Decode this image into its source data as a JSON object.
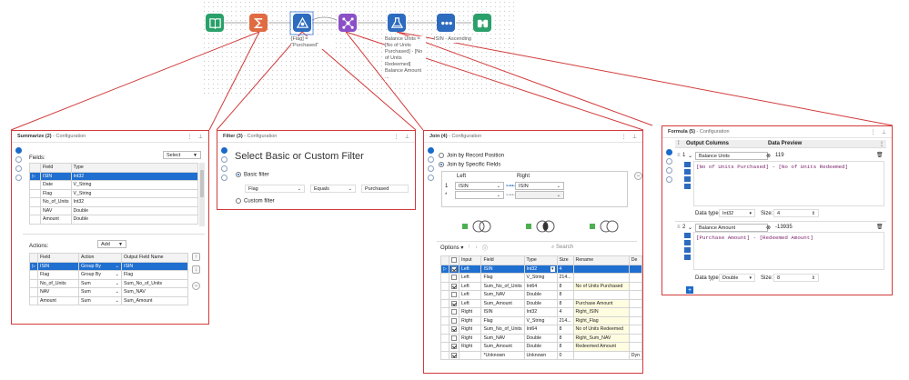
{
  "workflow": {
    "nodes": [
      {
        "name": "input-data-tool",
        "icon": "book-icon",
        "color": "#2aa06a"
      },
      {
        "name": "summarize-tool",
        "icon": "sigma-icon",
        "color": "#e06b43"
      },
      {
        "name": "filter-tool",
        "icon": "filter-icon",
        "color": "#2d6bbf"
      },
      {
        "name": "join-tool",
        "icon": "join-icon",
        "color": "#8b4fc6"
      },
      {
        "name": "formula-tool",
        "icon": "flask-icon",
        "color": "#2d6bbf"
      },
      {
        "name": "sort-tool",
        "icon": "sort-icon",
        "color": "#2d6bbf"
      },
      {
        "name": "browse-tool",
        "icon": "binoculars-icon",
        "color": "#2aa06a"
      }
    ],
    "filter_label": "[Flag] = \"Purchased\"",
    "formula_label": "Balance Units = [No of Units Purchased] - [No of Units Redeemed] Balance Amount ...",
    "sort_label": "ISIN - Ascending"
  },
  "summarize": {
    "title": "Summarize (2)",
    "subtitle": " - Configuration",
    "fields_label": "Fields:",
    "select_button": "Select",
    "field_headers": [
      "Field",
      "Type"
    ],
    "fields": [
      [
        "ISIN",
        "Int32"
      ],
      [
        "Date",
        "V_String"
      ],
      [
        "Flag",
        "V_String"
      ],
      [
        "No_of_Units",
        "Int32"
      ],
      [
        "NAV",
        "Double"
      ],
      [
        "Amount",
        "Double"
      ]
    ],
    "actions_label": "Actions:",
    "add_button": "Add",
    "action_headers": [
      "Field",
      "Action",
      "Output Field Name"
    ],
    "actions": [
      [
        "ISIN",
        "Group By",
        "ISIN"
      ],
      [
        "Flag",
        "Group By",
        "Flag"
      ],
      [
        "No_of_Units",
        "Sum",
        "Sum_No_of_Units"
      ],
      [
        "NAV",
        "Sum",
        "Sum_NAV"
      ],
      [
        "Amount",
        "Sum",
        "Sum_Amount"
      ]
    ]
  },
  "filter": {
    "title": "Filter (3)",
    "subtitle": " - Configuration",
    "heading": "Select Basic or Custom Filter",
    "basic_label": "Basic filter",
    "field": "Flag",
    "operator": "Equals",
    "value": "Purchased",
    "custom_label": "Custom filter"
  },
  "join": {
    "title": "Join (4)",
    "subtitle": " - Configuration",
    "by_position": "Join by Record Position",
    "by_fields": "Join by Specific Fields",
    "left_header": "Left",
    "right_header": "Right",
    "join_rows": [
      {
        "n": "1",
        "left": "ISIN",
        "right": "ISIN"
      },
      {
        "n": "*",
        "left": "",
        "right": ""
      }
    ],
    "options_label": "Options",
    "search_placeholder": "Search",
    "headers": [
      "Input",
      "Field",
      "Type",
      "Size",
      "Rename",
      "De"
    ],
    "rows": [
      {
        "checked": true,
        "input": "Left",
        "field": "ISIN",
        "type": "Int32",
        "size": "4",
        "rename": "",
        "sel": true
      },
      {
        "checked": false,
        "input": "Left",
        "field": "Flag",
        "type": "V_String",
        "size": "214...",
        "rename": ""
      },
      {
        "checked": true,
        "input": "Left",
        "field": "Sum_No_of_Units",
        "type": "Int64",
        "size": "8",
        "rename": "No of Units Purchased"
      },
      {
        "checked": false,
        "input": "Left",
        "field": "Sum_NAV",
        "type": "Double",
        "size": "8",
        "rename": ""
      },
      {
        "checked": true,
        "input": "Left",
        "field": "Sum_Amount",
        "type": "Double",
        "size": "8",
        "rename": "Purchase Amount"
      },
      {
        "checked": false,
        "input": "Right",
        "field": "ISIN",
        "type": "Int32",
        "size": "4",
        "rename": "Right_ISIN"
      },
      {
        "checked": false,
        "input": "Right",
        "field": "Flag",
        "type": "V_String",
        "size": "214...",
        "rename": "Right_Flag"
      },
      {
        "checked": true,
        "input": "Right",
        "field": "Sum_No_of_Units",
        "type": "Int64",
        "size": "8",
        "rename": "No of Units Redeemed"
      },
      {
        "checked": false,
        "input": "Right",
        "field": "Sum_NAV",
        "type": "Double",
        "size": "8",
        "rename": "Right_Sum_NAV"
      },
      {
        "checked": true,
        "input": "Right",
        "field": "Sum_Amount",
        "type": "Double",
        "size": "8",
        "rename": "Redeemed Amount"
      },
      {
        "checked": true,
        "input": "",
        "field": "*Unknown",
        "type": "Unknown",
        "size": "0",
        "rename": "",
        "last": "Dyn"
      }
    ]
  },
  "formula": {
    "title": "Formula (5)",
    "subtitle": " - Configuration",
    "col_output": "Output Columns",
    "col_preview": "Data Preview",
    "items": [
      {
        "n": "1",
        "name": "Balance Units",
        "preview": "119",
        "expr": "[No of Units Purchased] - [No of Units Redeemed]",
        "dtype": "Int32",
        "size": "4"
      },
      {
        "n": "2",
        "name": "Balance Amount",
        "preview": "-13935",
        "expr": "[Purchase Amount] - [Redeemed Amount]",
        "dtype": "Double",
        "size": "8"
      }
    ],
    "data_type_label": "Data type:",
    "size_label": "Size:"
  }
}
